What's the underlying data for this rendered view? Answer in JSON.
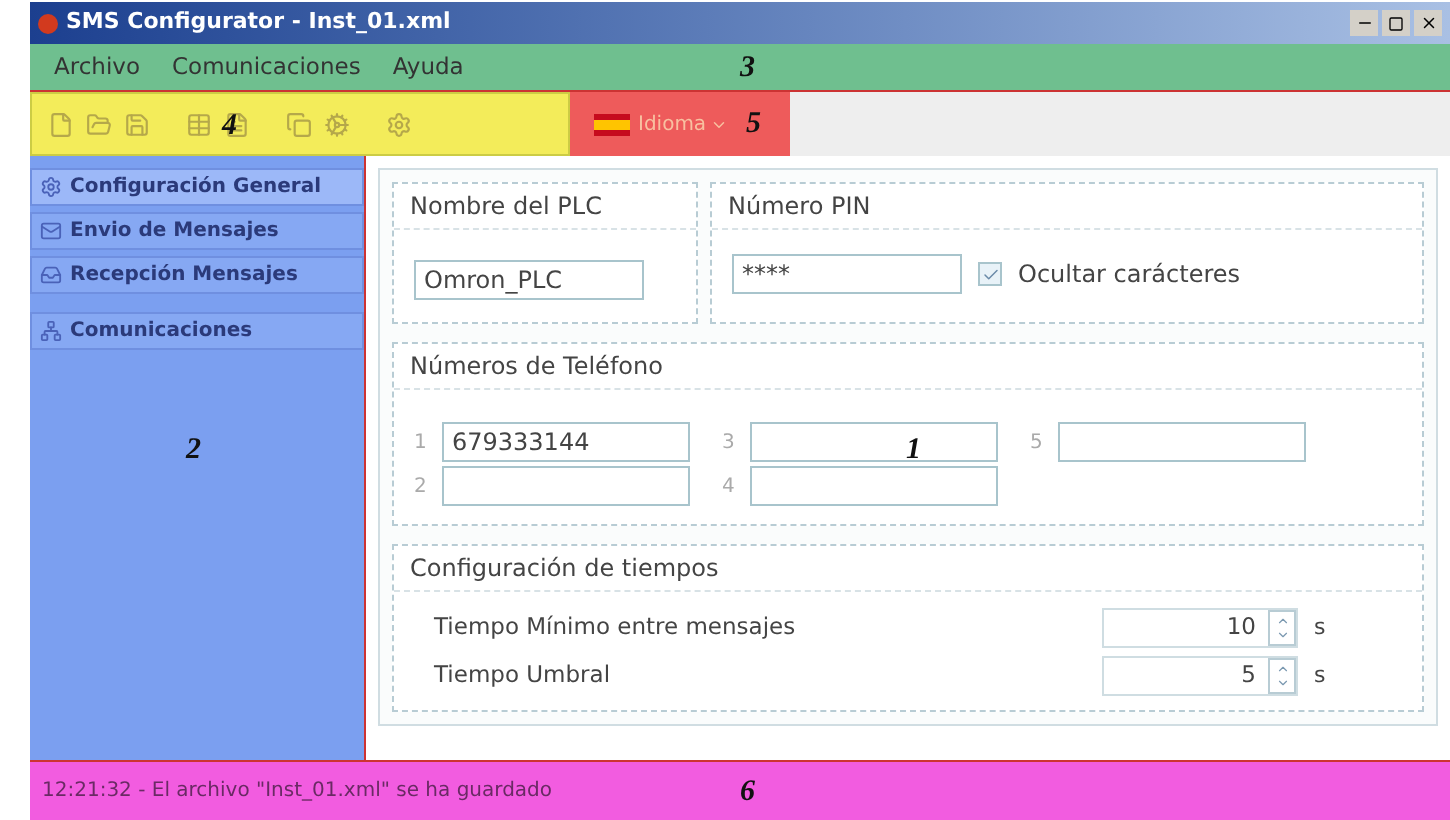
{
  "window": {
    "title": "SMS Configurator - Inst_01.xml"
  },
  "menu": {
    "annotation": "3",
    "items": [
      "Archivo",
      "Comunicaciones",
      "Ayuda"
    ]
  },
  "toolbar": {
    "annotation": "4"
  },
  "language": {
    "annotation": "5",
    "label": "Idioma"
  },
  "sidebar": {
    "annotation": "2",
    "items": [
      {
        "label": "Configuración General",
        "selected": true
      },
      {
        "label": "Envio de Mensajes",
        "selected": false
      },
      {
        "label": "Recepción Mensajes",
        "selected": false
      },
      {
        "label": "Comunicaciones",
        "selected": false
      }
    ]
  },
  "content": {
    "annotation": "1",
    "plc": {
      "title": "Nombre del PLC",
      "value": "Omron_PLC"
    },
    "pin": {
      "title": "Número PIN",
      "value": "****",
      "hide_label": "Ocultar carácteres",
      "checked": true
    },
    "phones": {
      "title": "Números de Teléfono",
      "entries": [
        {
          "index": "1",
          "value": "679333144"
        },
        {
          "index": "3"
        },
        {
          "index": "5"
        },
        {
          "index": "2"
        },
        {
          "index": "4"
        }
      ]
    },
    "timings": {
      "title": "Configuración de tiempos",
      "rows": [
        {
          "label": "Tiempo Mínimo entre mensajes",
          "value": "10",
          "unit": "s"
        },
        {
          "label": "Tiempo Umbral",
          "value": "5",
          "unit": "s"
        }
      ]
    }
  },
  "status_bar": {
    "annotation": "6",
    "message": "12:21:32 - El archivo \"Inst_01.xml\" se ha guardado"
  }
}
